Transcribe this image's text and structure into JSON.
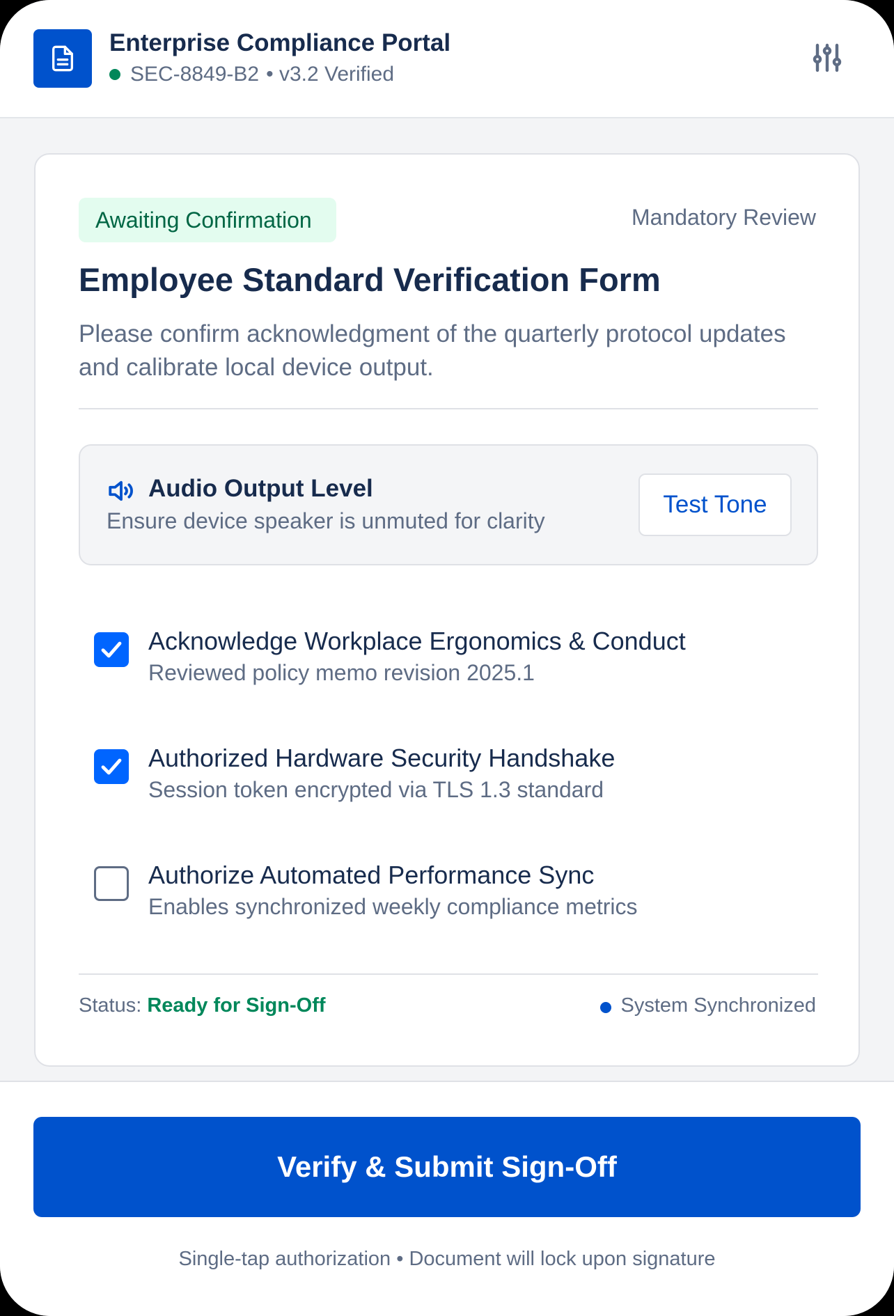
{
  "header": {
    "title": "Enterprise Compliance Portal",
    "session_id": "SEC-8849-B2",
    "version_status": "• v3.2 Verified",
    "app_icon": "document-icon",
    "settings_icon": "sliders-icon"
  },
  "card": {
    "badge": "Awaiting Confirmation",
    "review_type": "Mandatory Review",
    "title": "Employee Standard Verification Form",
    "description": "Please confirm acknowledgment of the quarterly protocol updates and calibrate local device output.",
    "audio": {
      "icon": "speaker-icon",
      "title": "Audio Output Level",
      "subtitle": "Ensure device speaker is unmuted for clarity",
      "button": "Test Tone"
    },
    "checklist": [
      {
        "label": "Acknowledge Workplace Ergonomics & Conduct",
        "sub": "Reviewed policy memo revision 2025.1",
        "checked": true
      },
      {
        "label": "Authorized Hardware Security Handshake",
        "sub": "Session token encrypted via TLS 1.3 standard",
        "checked": true
      },
      {
        "label": "Authorize Automated Performance Sync",
        "sub": "Enables synchronized weekly compliance metrics",
        "checked": false
      }
    ],
    "status_label": "Status:",
    "status_value": "Ready for Sign-Off",
    "sync_status": "System Synchronized"
  },
  "footer": {
    "submit_label": "Verify & Submit Sign-Off",
    "note": "Single-tap authorization • Document will lock upon signature"
  },
  "colors": {
    "primary": "#0052cc",
    "success": "#00875a",
    "badge_bg": "#e3fcef",
    "text_dark": "#172b4d",
    "text_muted": "#5e6c84"
  }
}
